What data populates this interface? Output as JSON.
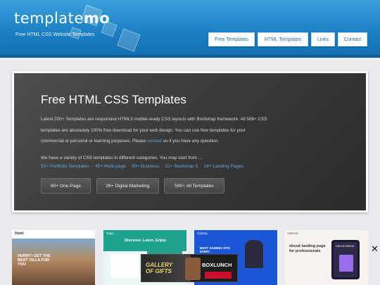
{
  "header": {
    "logo_prefix": "template",
    "logo_suffix": "mo",
    "tagline": "Free HTML CSS Website Templates",
    "nav": [
      "Free Templates",
      "HTML Templates",
      "Links",
      "Contact"
    ]
  },
  "hero": {
    "title": "Free HTML CSS Templates",
    "p1_a": "Latest 200+ Templates are responsive HTML5 mobile-ready CSS layouts with Bootstrap framework. All 588+ CSS",
    "p1_b": "templates are absolutely 100% free download for your web design. You can use free templates for your",
    "p1_c": "commercial or personal or learning purposes. Please",
    "p1_link": "contact",
    "p1_d": "us if you have any question.",
    "p2": "We have a variety of CSS templates in different categories. You may start from ...",
    "categories": [
      "50+ Portfolio Templates",
      "40+ Multi-page",
      "30+ Business",
      "31+ Bootstrap 5",
      "14+ Landing Pages"
    ],
    "buttons": [
      "60+ One-Page",
      "26+ Digital Marketing",
      "590+ All Templates"
    ]
  },
  "thumbnails": {
    "t1": {
      "brand": "Hotel",
      "headline": "HURRY! GET THE BEST VILLA FOR YOU"
    },
    "t2": {
      "brand": "Topic",
      "headline": "Discover. Learn. Enjoy"
    },
    "t3": {
      "brand": "Cyborg",
      "headline": "BEST GAMING SITE EVER!"
    },
    "t4": {
      "brand": "ordered",
      "headline": "ebook landing page for professionals",
      "badge": "ONLINE EBOOK"
    }
  },
  "ad": {
    "left_text": "GALLERY OF GIFTS",
    "right_text": "BOXLUNCH"
  },
  "close_symbol": "✕",
  "colors": {
    "header": "#1b7fc4",
    "link": "#5aa9e6",
    "hero_bg": "#3a3a3a"
  }
}
